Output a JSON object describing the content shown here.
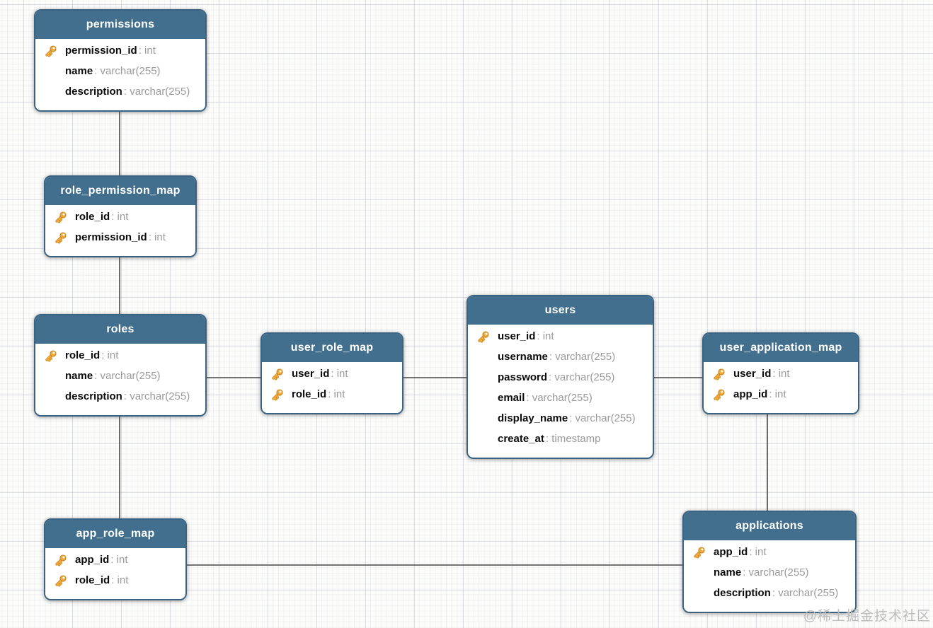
{
  "diagram": {
    "tables": [
      {
        "id": "permissions",
        "title": "permissions",
        "fields": [
          {
            "name": "permission_id",
            "type": "int",
            "key": true
          },
          {
            "name": "name",
            "type": "varchar(255)",
            "key": false
          },
          {
            "name": "description",
            "type": "varchar(255)",
            "key": false
          }
        ]
      },
      {
        "id": "role_permission_map",
        "title": "role_permission_map",
        "fields": [
          {
            "name": "role_id",
            "type": "int",
            "key": true
          },
          {
            "name": "permission_id",
            "type": "int",
            "key": true
          }
        ]
      },
      {
        "id": "roles",
        "title": "roles",
        "fields": [
          {
            "name": "role_id",
            "type": "int",
            "key": true
          },
          {
            "name": "name",
            "type": "varchar(255)",
            "key": false
          },
          {
            "name": "description",
            "type": "varchar(255)",
            "key": false
          }
        ]
      },
      {
        "id": "user_role_map",
        "title": "user_role_map",
        "fields": [
          {
            "name": "user_id",
            "type": "int",
            "key": true
          },
          {
            "name": "role_id",
            "type": "int",
            "key": true
          }
        ]
      },
      {
        "id": "users",
        "title": "users",
        "fields": [
          {
            "name": "user_id",
            "type": "int",
            "key": true
          },
          {
            "name": "username",
            "type": "varchar(255)",
            "key": false
          },
          {
            "name": "password",
            "type": "varchar(255)",
            "key": false
          },
          {
            "name": "email",
            "type": "varchar(255)",
            "key": false
          },
          {
            "name": "display_name",
            "type": "varchar(255)",
            "key": false
          },
          {
            "name": "create_at",
            "type": "timestamp",
            "key": false
          }
        ]
      },
      {
        "id": "user_application_map",
        "title": "user_application_map",
        "fields": [
          {
            "name": "user_id",
            "type": "int",
            "key": true
          },
          {
            "name": "app_id",
            "type": "int",
            "key": true
          }
        ]
      },
      {
        "id": "app_role_map",
        "title": "app_role_map",
        "fields": [
          {
            "name": "app_id",
            "type": "int",
            "key": true
          },
          {
            "name": "role_id",
            "type": "int",
            "key": true
          }
        ]
      },
      {
        "id": "applications",
        "title": "applications",
        "fields": [
          {
            "name": "app_id",
            "type": "int",
            "key": true
          },
          {
            "name": "name",
            "type": "varchar(255)",
            "key": false
          },
          {
            "name": "description",
            "type": "varchar(255)",
            "key": false
          }
        ]
      }
    ],
    "relations": [
      {
        "from": "permissions",
        "to": "role_permission_map"
      },
      {
        "from": "role_permission_map",
        "to": "roles"
      },
      {
        "from": "roles",
        "to": "user_role_map"
      },
      {
        "from": "user_role_map",
        "to": "users"
      },
      {
        "from": "users",
        "to": "user_application_map"
      },
      {
        "from": "user_application_map",
        "to": "applications"
      },
      {
        "from": "roles",
        "to": "app_role_map"
      },
      {
        "from": "app_role_map",
        "to": "applications"
      }
    ],
    "colors": {
      "header": "#426F8E",
      "border": "#3A6383",
      "key_icon": "#EDA93B",
      "field_type_text": "#9A9A9A",
      "relation_line": "#474747"
    }
  },
  "watermark": {
    "text": "@稀土掘金技术社区"
  }
}
